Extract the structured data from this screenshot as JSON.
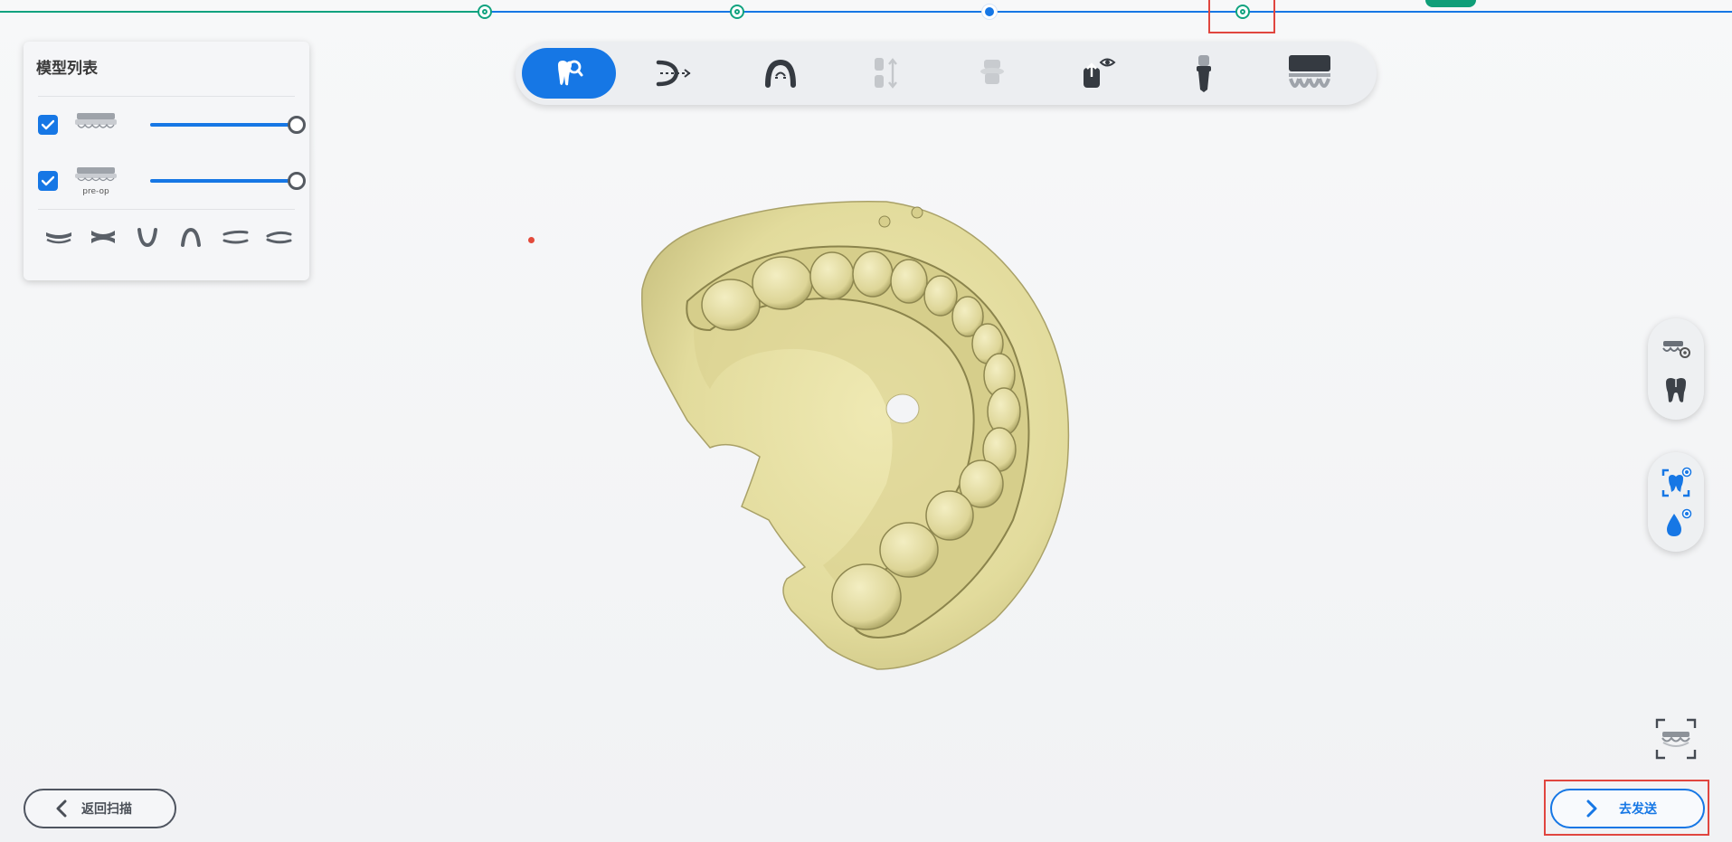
{
  "panel": {
    "title": "模型列表",
    "models": [
      {
        "name": "upper-jaw",
        "checked": true,
        "opacity": 1.0,
        "thumb_label": ""
      },
      {
        "name": "pre-op",
        "checked": true,
        "opacity": 1.0,
        "thumb_label": "pre-op"
      }
    ],
    "view_icons": [
      "view-front-icon",
      "view-side-icon",
      "view-lower-icon",
      "view-upper-icon",
      "view-left-icon",
      "view-right-icon"
    ]
  },
  "progress": {
    "steps": [
      "done",
      "done",
      "current",
      "done"
    ]
  },
  "toolbar": {
    "tools": [
      {
        "icon": "tooth-search-icon",
        "active": true,
        "enabled": true
      },
      {
        "icon": "margin-line-icon",
        "active": false,
        "enabled": true
      },
      {
        "icon": "arch-icon",
        "active": false,
        "enabled": true
      },
      {
        "icon": "occlusion-icon",
        "active": false,
        "enabled": false
      },
      {
        "icon": "die-icon",
        "active": false,
        "enabled": false
      },
      {
        "icon": "insertion-view-icon",
        "active": false,
        "enabled": true
      },
      {
        "icon": "implant-icon",
        "active": false,
        "enabled": true
      },
      {
        "icon": "full-arch-icon",
        "active": false,
        "enabled": true
      }
    ]
  },
  "buttons": {
    "back_label": "返回扫描",
    "send_label": "去发送"
  },
  "colors": {
    "accent": "#1677e5",
    "done": "#10a37f",
    "highlight": "#e0463f",
    "model": "#e8e2a6"
  }
}
